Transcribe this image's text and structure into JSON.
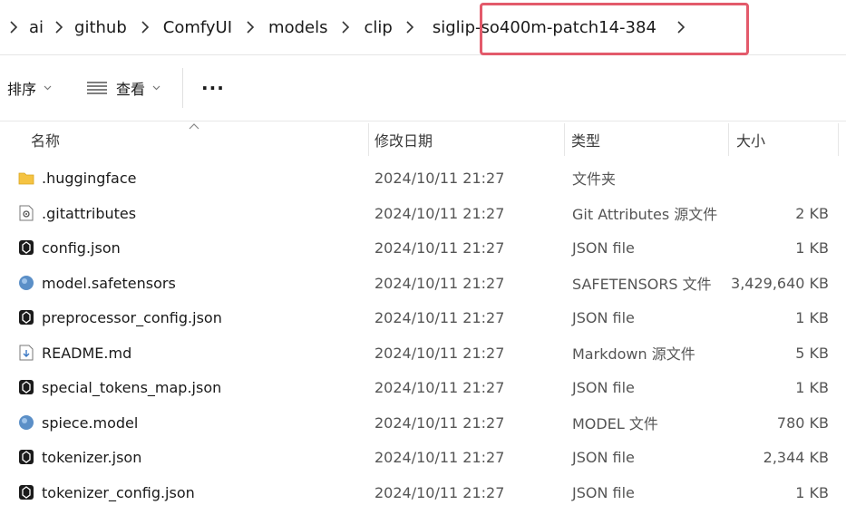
{
  "breadcrumb": {
    "items": [
      "ai",
      "github",
      "ComfyUI",
      "models",
      "clip",
      "siglip-so400m-patch14-384"
    ]
  },
  "toolbar": {
    "sort_label": "排序",
    "view_label": "查看",
    "more_label": "···"
  },
  "columns": {
    "name": "名称",
    "date": "修改日期",
    "type": "类型",
    "size": "大小"
  },
  "files": [
    {
      "name": ".huggingface",
      "date": "2024/10/11 21:27",
      "type": "文件夹",
      "size": "",
      "icon": "folder-icon"
    },
    {
      "name": ".gitattributes",
      "date": "2024/10/11 21:27",
      "type": "Git Attributes 源文件",
      "size": "2 KB",
      "icon": "settings-file-icon"
    },
    {
      "name": "config.json",
      "date": "2024/10/11 21:27",
      "type": "JSON file",
      "size": "1 KB",
      "icon": "json-file-icon"
    },
    {
      "name": "model.safetensors",
      "date": "2024/10/11 21:27",
      "type": "SAFETENSORS 文件",
      "size": "3,429,640 KB",
      "icon": "model-file-icon"
    },
    {
      "name": "preprocessor_config.json",
      "date": "2024/10/11 21:27",
      "type": "JSON file",
      "size": "1 KB",
      "icon": "json-file-icon"
    },
    {
      "name": "README.md",
      "date": "2024/10/11 21:27",
      "type": "Markdown 源文件",
      "size": "5 KB",
      "icon": "markdown-file-icon"
    },
    {
      "name": "special_tokens_map.json",
      "date": "2024/10/11 21:27",
      "type": "JSON file",
      "size": "1 KB",
      "icon": "json-file-icon"
    },
    {
      "name": "spiece.model",
      "date": "2024/10/11 21:27",
      "type": "MODEL 文件",
      "size": "780 KB",
      "icon": "model-file-icon"
    },
    {
      "name": "tokenizer.json",
      "date": "2024/10/11 21:27",
      "type": "JSON file",
      "size": "2,344 KB",
      "icon": "json-file-icon"
    },
    {
      "name": "tokenizer_config.json",
      "date": "2024/10/11 21:27",
      "type": "JSON file",
      "size": "1 KB",
      "icon": "json-file-icon"
    }
  ],
  "colors": {
    "highlight": "#e35a6b",
    "folder": "#f5c342"
  }
}
